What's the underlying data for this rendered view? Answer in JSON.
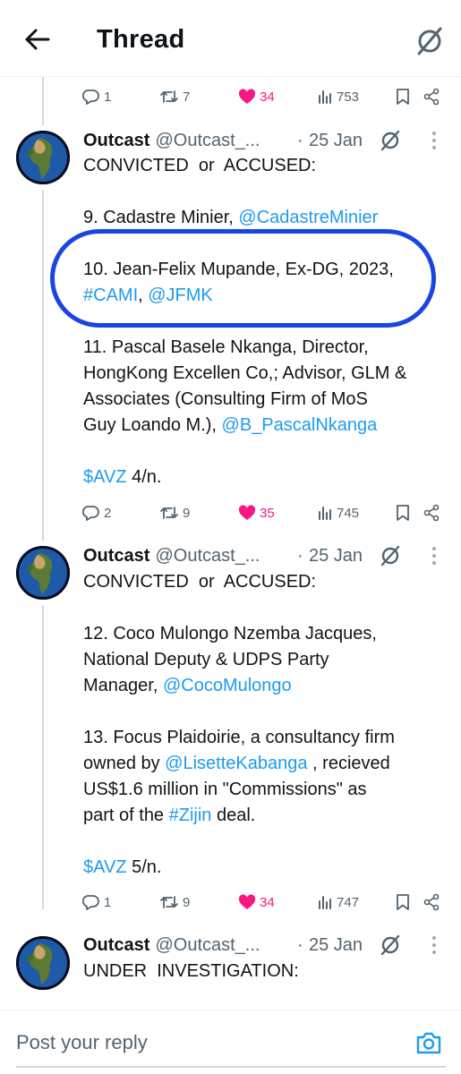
{
  "header": {
    "title": "Thread",
    "back_icon": "arrow-left-icon",
    "grok_icon": "grok-icon"
  },
  "colors": {
    "accent": "#1d9bf0",
    "like": "#f91880",
    "highlight_ring": "#1a45e0",
    "muted": "#536471"
  },
  "top_actions": {
    "replies": "1",
    "reposts": "7",
    "likes": "34",
    "views": "753"
  },
  "tweets": [
    {
      "name": "Outcast",
      "handle": "@Outcast_...",
      "dot": "·",
      "time": "25 Jan",
      "heading": "CONVICTED  or  ACCUSED:",
      "item9_text": "9. Cadastre Minier, ",
      "item9_link": "@CadastreMinier",
      "item10_line1": "10. Jean-Felix Mupande, Ex-DG, 2023,",
      "item10_hashtag": "#CAMI",
      "item10_sep": ", ",
      "item10_mention": "@JFMK",
      "item11_line1": "11. Pascal Basele Nkanga, Director,",
      "item11_line2": "HongKong Excellen Co,; Advisor, GLM &",
      "item11_line3": "Associates (Consulting Firm of MoS",
      "item11_line4": "Guy Loando M.), ",
      "item11_link": "@B_PascalNkanga",
      "cashtag": "$AVZ",
      "footer": " 4/n.",
      "actions": {
        "replies": "2",
        "reposts": "9",
        "likes": "35",
        "views": "745"
      }
    },
    {
      "name": "Outcast",
      "handle": "@Outcast_...",
      "dot": "·",
      "time": "25 Jan",
      "heading": "CONVICTED  or  ACCUSED:",
      "item12_line1": "12. Coco Mulongo Nzemba Jacques,",
      "item12_line2": "National Deputy & UDPS Party",
      "item12_line3": "Manager, ",
      "item12_link": "@CocoMulongo",
      "item13_line1": "13. Focus Plaidoirie, a consultancy firm",
      "item13_line2_pre": "owned by ",
      "item13_link": "@LisetteKabanga",
      "item13_line2_post": " , recieved",
      "item13_line3": "US$1.6 million in \"Commissions\" as",
      "item13_line4_pre": "part of the ",
      "item13_hashtag": "#Zijin",
      "item13_line4_post": " deal.",
      "cashtag": "$AVZ",
      "footer": " 5/n.",
      "actions": {
        "replies": "1",
        "reposts": "9",
        "likes": "34",
        "views": "747"
      }
    },
    {
      "name": "Outcast",
      "handle": "@Outcast_...",
      "dot": "·",
      "time": "25 Jan",
      "heading": "UNDER  INVESTIGATION:"
    }
  ],
  "reply": {
    "placeholder": "Post your reply",
    "camera_icon": "camera-icon"
  }
}
